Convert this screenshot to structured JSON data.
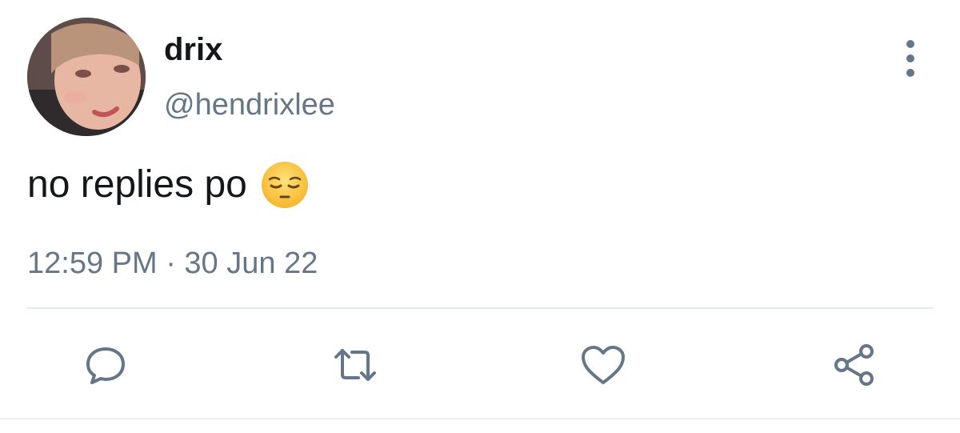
{
  "tweet": {
    "display_name": "drix",
    "handle": "@hendrixlee",
    "text": "no replies po",
    "emoji": "pensive-face",
    "timestamp": "12:59 PM · 30 Jun 22"
  },
  "actions": [
    {
      "name": "reply",
      "icon": "speech-bubble-icon"
    },
    {
      "name": "retweet",
      "icon": "retweet-icon"
    },
    {
      "name": "like",
      "icon": "heart-icon"
    },
    {
      "name": "share",
      "icon": "share-icon"
    }
  ],
  "colors": {
    "text": "#14171a",
    "secondary": "#657786",
    "divider": "#e1e8ed"
  }
}
